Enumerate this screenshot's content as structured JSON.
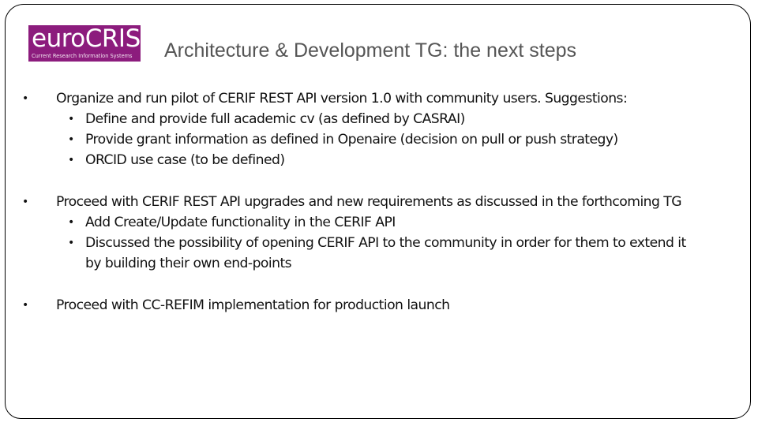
{
  "slide": {
    "logo": {
      "brand_euro": "euro",
      "brand_cris": "CRIS",
      "tagline": "Current Research Information Systems",
      "color": "#8c1c7d"
    },
    "title": "Architecture & Development TG: the next steps",
    "bullet_glyph": "•",
    "bullets": [
      {
        "text": "Organize and run pilot of CERIF REST API version 1.0 with community users. Suggestions:",
        "sub": [
          {
            "text": "Define and provide full academic cv (as defined by CASRAI)"
          },
          {
            "text": "Provide grant information as defined in Openaire (decision on pull or push strategy)"
          },
          {
            "text": "ORCID use case (to be defined)"
          }
        ]
      },
      {
        "text": "Proceed with CERIF REST API upgrades and new requirements as discussed in the forthcoming TG",
        "sub": [
          {
            "text": "Add Create/Update functionality in the CERIF API"
          },
          {
            "text": "Discussed the possibility of opening CERIF API to the community in order for them to extend it",
            "continuation": "by building their own end-points"
          }
        ]
      },
      {
        "text": "Proceed with CC-REFIM implementation for production launch",
        "sub": []
      }
    ]
  }
}
